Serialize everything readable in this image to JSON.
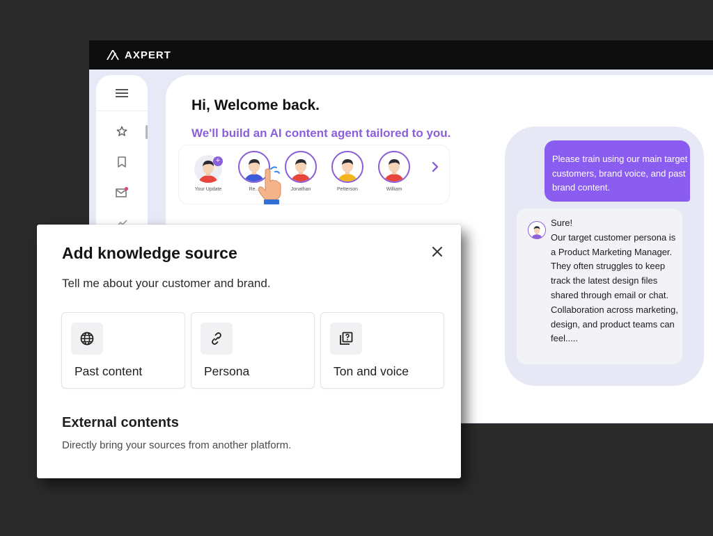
{
  "brand": {
    "name": "AXPERT"
  },
  "main": {
    "greeting": "Hi, Welcome back.",
    "tagline": "We'll build an AI content agent tailored to you.",
    "avatars": [
      {
        "label": "Your Update"
      },
      {
        "label": "Re..."
      },
      {
        "label": "Jonathan"
      },
      {
        "label": "Petterson"
      },
      {
        "label": "William"
      }
    ]
  },
  "chat": {
    "user_message": "Please train using our main target customers, brand voice, and past brand content.",
    "bot_message": "Sure!\nOur target customer persona is a Product Marketing Manager.\nThey often struggles to keep track the latest design files shared through email or chat. Collaboration across marketing, design, and product teams can feel....."
  },
  "modal": {
    "title": "Add knowledge source",
    "subtitle": "Tell me about your customer and brand.",
    "options": [
      {
        "label": "Past content",
        "icon": "globe-icon"
      },
      {
        "label": "Persona",
        "icon": "link-icon"
      },
      {
        "label": "Ton and voice",
        "icon": "library-help-icon"
      }
    ],
    "external_title": "External contents",
    "external_desc": "Directly bring your sources from another platform."
  },
  "colors": {
    "accent": "#8b5fd9",
    "user_bubble": "#8b5cf0",
    "topbar": "#0d0d0d",
    "background": "#2a2a2a"
  }
}
